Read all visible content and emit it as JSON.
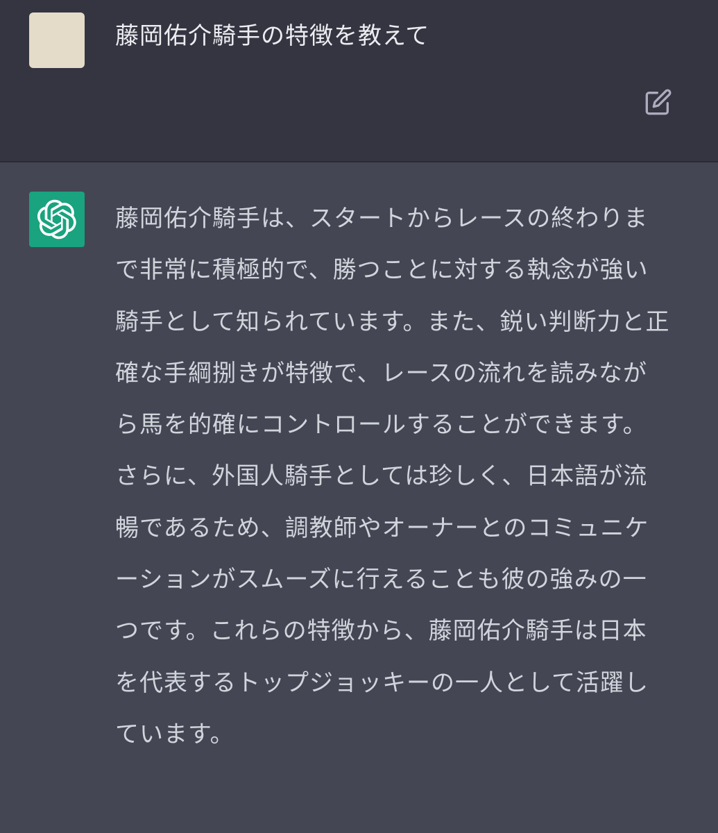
{
  "user_message": {
    "avatar": "user-avatar-image",
    "text": "藤岡佑介騎手の特徴を教えて",
    "edit_icon": "edit-icon"
  },
  "assistant_message": {
    "avatar": "openai-logo-icon",
    "text": "藤岡佑介騎手は、スタートからレースの終わりまで非常に積極的で、勝つことに対する執念が強い騎手として知られています。また、鋭い判断力と正確な手綱捌きが特徴で、レースの流れを読みながら馬を的確にコントロールすることができます。さらに、外国人騎手としては珍しく、日本語が流暢であるため、調教師やオーナーとのコミュニケーションがスムーズに行えることも彼の強みの一つです。これらの特徴から、藤岡佑介騎手は日本を代表するトップジョッキーの一人として活躍しています。"
  },
  "colors": {
    "user_bg": "#343541",
    "assistant_bg": "#444654",
    "ai_avatar": "#19a37f",
    "text": "#d1d5db"
  }
}
